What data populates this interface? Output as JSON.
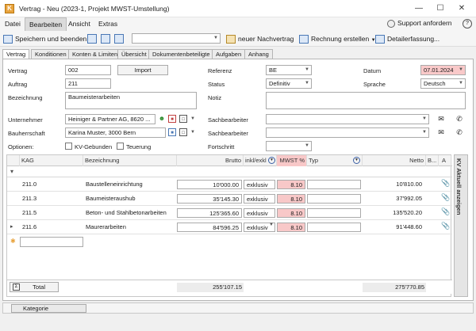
{
  "window": {
    "title": "Vertrag - Neu (2023-1, Projekt MWST-Umstellung)",
    "app_letter": "K",
    "minimize": "—",
    "maximize": "☐",
    "close": "✕"
  },
  "menu": {
    "items": [
      "Datei",
      "Bearbeiten",
      "Ansicht",
      "Extras"
    ],
    "support": "Support anfordern",
    "help": "?"
  },
  "toolbar": {
    "save_close": "Speichern und beenden",
    "new_addendum": "neuer Nachvertrag",
    "create_invoice": "Rechnung erstellen",
    "detail_entry": "Detailerfassung..."
  },
  "tabs": [
    "Vertrag",
    "Konditionen",
    "Konten & Limiten",
    "Übersicht",
    "Dokumentenbeteiligte",
    "Aufgaben",
    "Anhang"
  ],
  "form": {
    "vertrag_label": "Vertrag",
    "vertrag_value": "002",
    "import_button": "Import",
    "auftrag_label": "Auftrag",
    "auftrag_value": "211",
    "bezeichnung_label": "Bezeichnung",
    "bezeichnung_value": "Baumeisterarbeiten",
    "unternehmer_label": "Unternehmer",
    "unternehmer_value": "Heiniger & Partner AG, 8620 ...",
    "bauherrschaft_label": "Bauherrschaft",
    "bauherrschaft_value": "Karina Muster, 3000 Bern",
    "optionen_label": "Optionen:",
    "kv_gebunden": "KV-Gebunden",
    "teuerung": "Teuerung",
    "referenz_label": "Referenz",
    "referenz_value": "BE",
    "status_label": "Status",
    "status_value": "Definitiv",
    "notiz_label": "Notiz",
    "sachbearbeiter1_label": "Sachbearbeiter",
    "sachbearbeiter2_label": "Sachbearbeiter",
    "fortschritt_label": "Fortschritt",
    "datum_label": "Datum",
    "datum_value": "07.01.2024",
    "sprache_label": "Sprache",
    "sprache_value": "Deutsch"
  },
  "grid": {
    "headers": {
      "kag": "KAG",
      "bezeichnung": "Bezeichnung",
      "brutto": "Brutto",
      "inkl": "inkl/exkl",
      "mwst": "MWST %",
      "typ": "Typ",
      "netto": "Netto",
      "b": "B...",
      "a": "A"
    },
    "rows": [
      {
        "kag": "211.0",
        "bezeichnung": "Baustelleneinrichtung",
        "brutto": "10'000.00",
        "inkl": "exklusiv",
        "mwst": "8.10",
        "netto": "10'810.00"
      },
      {
        "kag": "211.3",
        "bezeichnung": "Baumeisteraushub",
        "brutto": "35'145.30",
        "inkl": "exklusiv",
        "mwst": "8.10",
        "netto": "37'992.05"
      },
      {
        "kag": "211.5",
        "bezeichnung": "Beton- und Stahlbetonarbeiten",
        "brutto": "125'365.60",
        "inkl": "exklusiv",
        "mwst": "8.10",
        "netto": "135'520.20"
      },
      {
        "kag": "211.6",
        "bezeichnung": "Maurerarbeiten",
        "brutto": "84'596.25",
        "inkl": "exklusiv",
        "mwst": "8.10",
        "netto": "91'448.60"
      }
    ],
    "total_label": "Total",
    "total_brutto": "255'107.15",
    "total_netto": "275'770.85"
  },
  "sidebar": {
    "label": "KV Aktuell anzeigen"
  },
  "bottom": {
    "kategorie": "Kategorie"
  }
}
